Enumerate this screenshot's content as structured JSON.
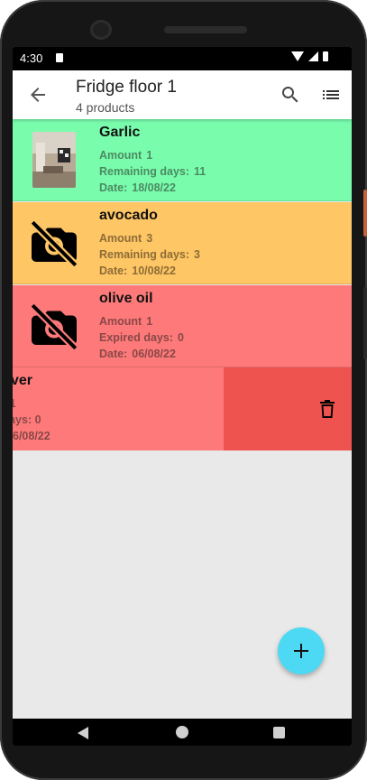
{
  "status_bar": {
    "time": "4:30"
  },
  "app_bar": {
    "title": "Fridge floor 1",
    "subtitle": "4 products"
  },
  "products": [
    {
      "name": "Garlic",
      "amount_label": "Amount",
      "amount": "1",
      "days_label": "Remaining days:",
      "days": "11",
      "date_label": "Date:",
      "date": "18/08/22",
      "background": "#79fdad",
      "image": "photo"
    },
    {
      "name": "avocado",
      "amount_label": "Amount",
      "amount": "3",
      "days_label": "Remaining days:",
      "days": "3",
      "date_label": "Date:",
      "date": "10/08/22",
      "background": "#fec664",
      "image": "no-photo-icon"
    },
    {
      "name": "olive oil",
      "amount_label": "Amount",
      "amount": "1",
      "days_label": "Expired days:",
      "days": "0",
      "date_label": "Date:",
      "date": "06/08/22",
      "background": "#fe7a7a",
      "image": "no-photo-icon"
    }
  ],
  "swiped_row": {
    "name_fragment": "ver",
    "amount_fragment": ": 1",
    "days_fragment": " days: 0",
    "date_fragment": "6/08/22",
    "background": "#fe7a7a",
    "delete_background": "#ef5350"
  },
  "colors": {
    "fab": "#4dd9f3",
    "fresh": "#79fdad",
    "warning": "#fec664",
    "expired": "#fe7a7a"
  }
}
